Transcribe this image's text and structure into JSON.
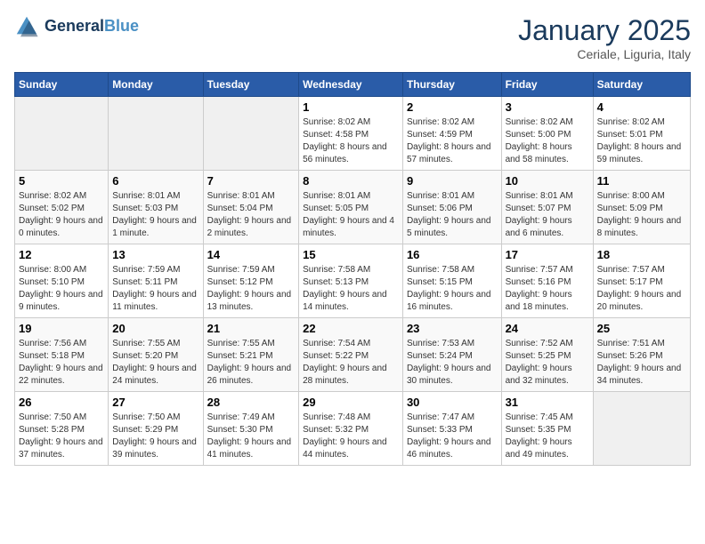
{
  "header": {
    "logo_line1": "General",
    "logo_line2": "Blue",
    "month": "January 2025",
    "location": "Ceriale, Liguria, Italy"
  },
  "days_of_week": [
    "Sunday",
    "Monday",
    "Tuesday",
    "Wednesday",
    "Thursday",
    "Friday",
    "Saturday"
  ],
  "weeks": [
    [
      {
        "day": "",
        "empty": true
      },
      {
        "day": "",
        "empty": true
      },
      {
        "day": "",
        "empty": true
      },
      {
        "day": "1",
        "sunrise": "8:02 AM",
        "sunset": "4:58 PM",
        "daylight": "8 hours and 56 minutes."
      },
      {
        "day": "2",
        "sunrise": "8:02 AM",
        "sunset": "4:59 PM",
        "daylight": "8 hours and 57 minutes."
      },
      {
        "day": "3",
        "sunrise": "8:02 AM",
        "sunset": "5:00 PM",
        "daylight": "8 hours and 58 minutes."
      },
      {
        "day": "4",
        "sunrise": "8:02 AM",
        "sunset": "5:01 PM",
        "daylight": "8 hours and 59 minutes."
      }
    ],
    [
      {
        "day": "5",
        "sunrise": "8:02 AM",
        "sunset": "5:02 PM",
        "daylight": "9 hours and 0 minutes."
      },
      {
        "day": "6",
        "sunrise": "8:01 AM",
        "sunset": "5:03 PM",
        "daylight": "9 hours and 1 minute."
      },
      {
        "day": "7",
        "sunrise": "8:01 AM",
        "sunset": "5:04 PM",
        "daylight": "9 hours and 2 minutes."
      },
      {
        "day": "8",
        "sunrise": "8:01 AM",
        "sunset": "5:05 PM",
        "daylight": "9 hours and 4 minutes."
      },
      {
        "day": "9",
        "sunrise": "8:01 AM",
        "sunset": "5:06 PM",
        "daylight": "9 hours and 5 minutes."
      },
      {
        "day": "10",
        "sunrise": "8:01 AM",
        "sunset": "5:07 PM",
        "daylight": "9 hours and 6 minutes."
      },
      {
        "day": "11",
        "sunrise": "8:00 AM",
        "sunset": "5:09 PM",
        "daylight": "9 hours and 8 minutes."
      }
    ],
    [
      {
        "day": "12",
        "sunrise": "8:00 AM",
        "sunset": "5:10 PM",
        "daylight": "9 hours and 9 minutes."
      },
      {
        "day": "13",
        "sunrise": "7:59 AM",
        "sunset": "5:11 PM",
        "daylight": "9 hours and 11 minutes."
      },
      {
        "day": "14",
        "sunrise": "7:59 AM",
        "sunset": "5:12 PM",
        "daylight": "9 hours and 13 minutes."
      },
      {
        "day": "15",
        "sunrise": "7:58 AM",
        "sunset": "5:13 PM",
        "daylight": "9 hours and 14 minutes."
      },
      {
        "day": "16",
        "sunrise": "7:58 AM",
        "sunset": "5:15 PM",
        "daylight": "9 hours and 16 minutes."
      },
      {
        "day": "17",
        "sunrise": "7:57 AM",
        "sunset": "5:16 PM",
        "daylight": "9 hours and 18 minutes."
      },
      {
        "day": "18",
        "sunrise": "7:57 AM",
        "sunset": "5:17 PM",
        "daylight": "9 hours and 20 minutes."
      }
    ],
    [
      {
        "day": "19",
        "sunrise": "7:56 AM",
        "sunset": "5:18 PM",
        "daylight": "9 hours and 22 minutes."
      },
      {
        "day": "20",
        "sunrise": "7:55 AM",
        "sunset": "5:20 PM",
        "daylight": "9 hours and 24 minutes."
      },
      {
        "day": "21",
        "sunrise": "7:55 AM",
        "sunset": "5:21 PM",
        "daylight": "9 hours and 26 minutes."
      },
      {
        "day": "22",
        "sunrise": "7:54 AM",
        "sunset": "5:22 PM",
        "daylight": "9 hours and 28 minutes."
      },
      {
        "day": "23",
        "sunrise": "7:53 AM",
        "sunset": "5:24 PM",
        "daylight": "9 hours and 30 minutes."
      },
      {
        "day": "24",
        "sunrise": "7:52 AM",
        "sunset": "5:25 PM",
        "daylight": "9 hours and 32 minutes."
      },
      {
        "day": "25",
        "sunrise": "7:51 AM",
        "sunset": "5:26 PM",
        "daylight": "9 hours and 34 minutes."
      }
    ],
    [
      {
        "day": "26",
        "sunrise": "7:50 AM",
        "sunset": "5:28 PM",
        "daylight": "9 hours and 37 minutes."
      },
      {
        "day": "27",
        "sunrise": "7:50 AM",
        "sunset": "5:29 PM",
        "daylight": "9 hours and 39 minutes."
      },
      {
        "day": "28",
        "sunrise": "7:49 AM",
        "sunset": "5:30 PM",
        "daylight": "9 hours and 41 minutes."
      },
      {
        "day": "29",
        "sunrise": "7:48 AM",
        "sunset": "5:32 PM",
        "daylight": "9 hours and 44 minutes."
      },
      {
        "day": "30",
        "sunrise": "7:47 AM",
        "sunset": "5:33 PM",
        "daylight": "9 hours and 46 minutes."
      },
      {
        "day": "31",
        "sunrise": "7:45 AM",
        "sunset": "5:35 PM",
        "daylight": "9 hours and 49 minutes."
      },
      {
        "day": "",
        "empty": true
      }
    ]
  ]
}
